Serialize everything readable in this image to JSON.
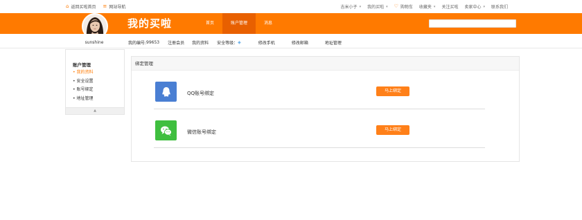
{
  "topbar": {
    "home_link": "返回买啦首页",
    "site_nav": "网站导航",
    "user": "吉米小子",
    "my_maila": "我的买啦",
    "cart": "购物车",
    "favorites": "收藏夹",
    "follow": "关注买啦",
    "seller_center": "卖家中心",
    "contact": "联系我们"
  },
  "header": {
    "logo": "我的买啦",
    "nav": [
      {
        "label": "首页"
      },
      {
        "label": "账户管理"
      },
      {
        "label": "消息"
      }
    ],
    "search_value": ""
  },
  "infobar": {
    "username": "sunshine",
    "account_label": "我的编号:",
    "account_number": "99653",
    "member": "注册会员",
    "profile": "我的资料",
    "security_label": "安全等级：",
    "change_phone": "修改手机",
    "change_email": "修改邮箱",
    "address": "地址管理"
  },
  "sidebar": {
    "title": "账户管理",
    "items": [
      {
        "label": "我的资料"
      },
      {
        "label": "安全设置"
      },
      {
        "label": "账号绑定"
      },
      {
        "label": "地址管理"
      }
    ]
  },
  "panel": {
    "title": "绑定管理",
    "rows": [
      {
        "label": "QQ账号绑定",
        "button": "马上绑定"
      },
      {
        "label": "微信账号绑定",
        "button": "马上绑定"
      }
    ]
  },
  "colors": {
    "brand_orange": "#ff7a00",
    "nav_active": "#e86000",
    "qq_blue": "#4a7fd3",
    "wechat_green": "#3fbf3f",
    "button_orange": "#ff8019"
  }
}
